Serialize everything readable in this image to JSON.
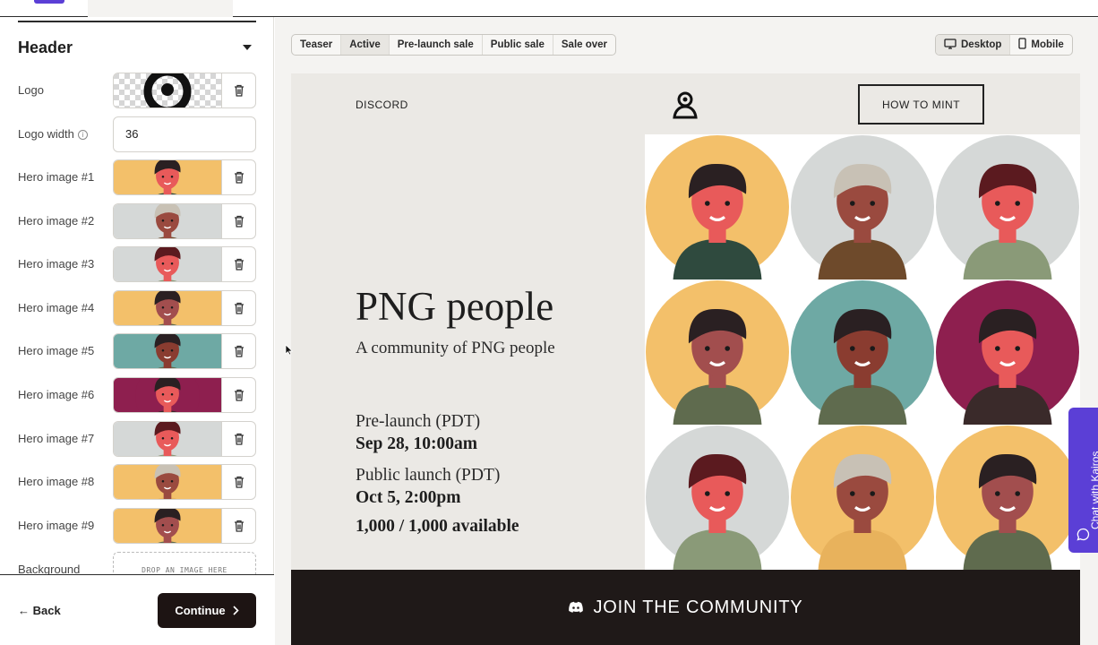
{
  "sidebar": {
    "section_title": "Header",
    "logo_label": "Logo",
    "logo_width_label": "Logo width",
    "logo_width_value": "36",
    "hero_images": [
      {
        "label": "Hero image #1",
        "bg": "#f3c06a",
        "skin": "#e85a5a",
        "hair": "#2a2022",
        "shirt": "#2f4a3e"
      },
      {
        "label": "Hero image #2",
        "bg": "#d5d8d7",
        "skin": "#9a4a3f",
        "hair": "#c8c1b5",
        "shirt": "#6e4a2b"
      },
      {
        "label": "Hero image #3",
        "bg": "#d5d8d7",
        "skin": "#e85a5a",
        "hair": "#5b1a1f",
        "shirt": "#8a9a78"
      },
      {
        "label": "Hero image #4",
        "bg": "#f3c06a",
        "skin": "#a24e4e",
        "hair": "#2a2022",
        "shirt": "#5f6b4e"
      },
      {
        "label": "Hero image #5",
        "bg": "#6ea9a4",
        "skin": "#8a3c30",
        "hair": "#2a2022",
        "shirt": "#5f6b4e"
      },
      {
        "label": "Hero image #6",
        "bg": "#8e1f4f",
        "skin": "#e85a5a",
        "hair": "#2a2022",
        "shirt": "#3a2a2a"
      },
      {
        "label": "Hero image #7",
        "bg": "#d5d8d7",
        "skin": "#e85a5a",
        "hair": "#5b1a1f",
        "shirt": "#8a9a78"
      },
      {
        "label": "Hero image #8",
        "bg": "#f3c06a",
        "skin": "#9a4a3f",
        "hair": "#c8c1b5",
        "shirt": "#e8b25c"
      },
      {
        "label": "Hero image #9",
        "bg": "#f3c06a",
        "skin": "#a24e4e",
        "hair": "#2a2022",
        "shirt": "#5f6b4e"
      }
    ],
    "background_label": "Background",
    "dropzone_text": "DROP AN IMAGE HERE",
    "back_label": "Back",
    "continue_label": "Continue"
  },
  "toolbar": {
    "states": [
      "Teaser",
      "Active",
      "Pre-launch sale",
      "Public sale",
      "Sale over"
    ],
    "active_state": "Active",
    "devices": [
      "Desktop",
      "Mobile"
    ],
    "active_device": "Desktop"
  },
  "preview": {
    "nav_link": "DISCORD",
    "nav_cta": "HOW TO MINT",
    "title": "PNG people",
    "subtitle": "A community of PNG people",
    "prelaunch_label": "Pre-launch (PDT)",
    "prelaunch_date": "Sep 28, 10:00am",
    "public_label": "Public launch (PDT)",
    "public_date": "Oct 5, 2:00pm",
    "availability": "1,000 / 1,000 available",
    "join_label": "JOIN THE COMMUNITY"
  },
  "chat": {
    "label": "Chat with Kairos"
  },
  "colors": {
    "accent": "#5b3fd6",
    "dark": "#1d1413",
    "preview_bg": "#ebe9e5"
  }
}
